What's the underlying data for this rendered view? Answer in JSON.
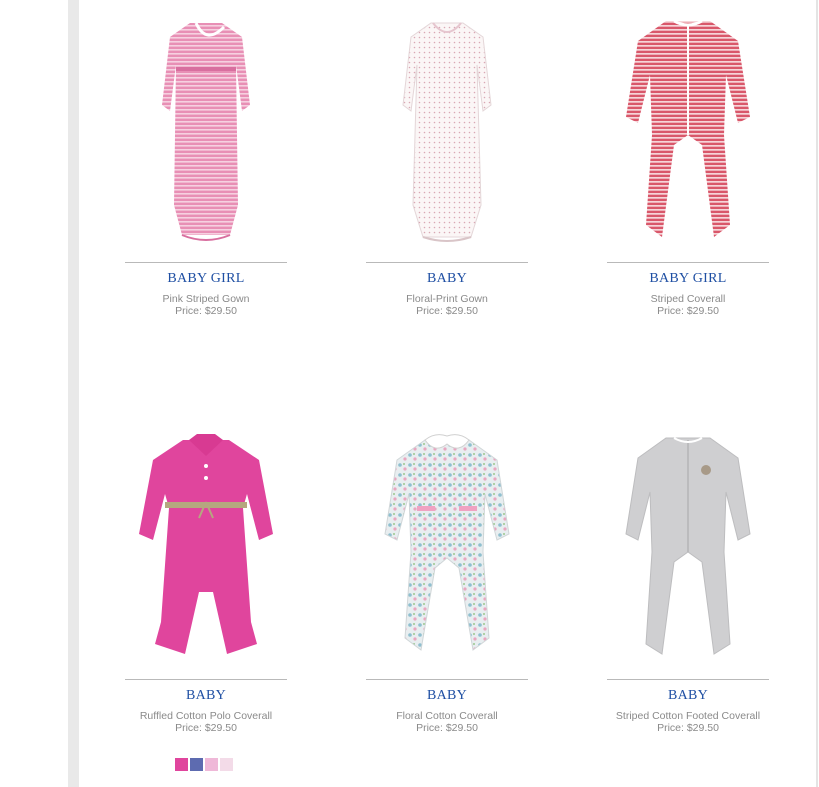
{
  "products": [
    {
      "category": "BABY GIRL",
      "name": "Pink Striped Gown",
      "price": "Price: $29.50",
      "icon": "pink-striped-gown-image"
    },
    {
      "category": "BABY",
      "name": "Floral-Print Gown",
      "price": "Price: $29.50",
      "icon": "floral-print-gown-image"
    },
    {
      "category": "BABY GIRL",
      "name": "Striped Coverall",
      "price": "Price: $29.50",
      "icon": "striped-coverall-image"
    },
    {
      "category": "BABY",
      "name": "Ruffled Cotton Polo Coverall",
      "price": "Price: $29.50",
      "icon": "ruffled-polo-coverall-image"
    },
    {
      "category": "BABY",
      "name": "Floral Cotton Coverall",
      "price": "Price: $29.50",
      "icon": "floral-cotton-coverall-image"
    },
    {
      "category": "BABY",
      "name": "Striped Cotton Footed Coverall",
      "price": "Price: $29.50",
      "icon": "striped-footed-coverall-image"
    }
  ],
  "swatches": [
    "#e0459d",
    "#5d6bb0",
    "#efb8d8",
    "#f3dbe8"
  ],
  "colors": {
    "category": "#1f4fa3",
    "text": "#8a8a8a",
    "rule": "#b9b9b9"
  }
}
